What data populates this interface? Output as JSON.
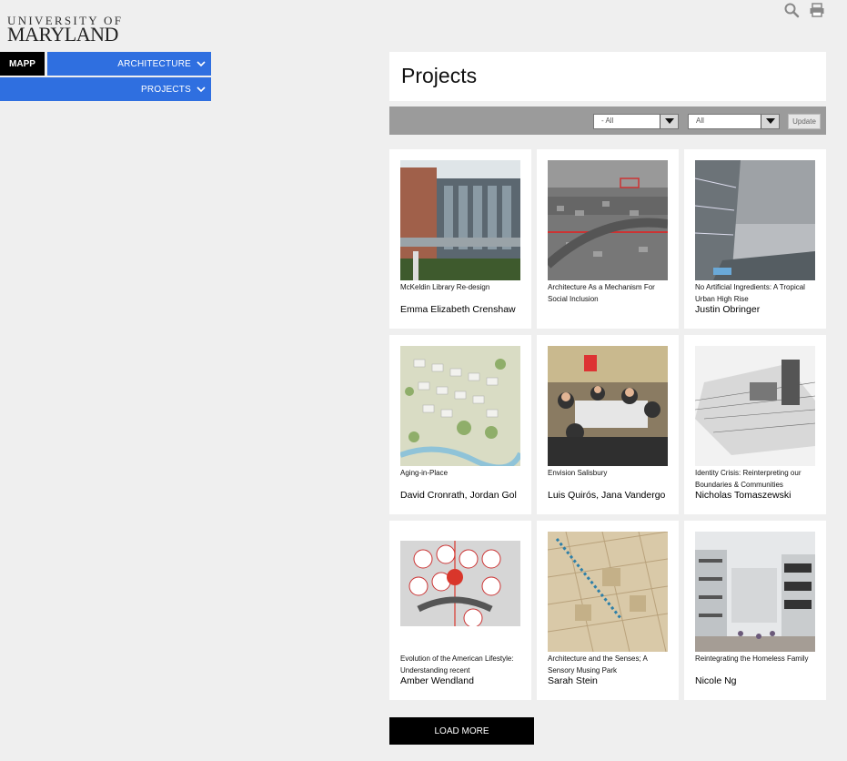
{
  "logo": {
    "line1": "UNIVERSITY OF",
    "line2": "MARYLAND"
  },
  "tools": {
    "search_icon": "search-icon",
    "print_icon": "print-icon"
  },
  "nav": {
    "mapp": "MAPP",
    "architecture": "ARCHITECTURE",
    "projects": "PROJECTS",
    "accent": "#2f6fe0"
  },
  "page": {
    "title": "Projects"
  },
  "filters": {
    "select1": "- All",
    "select2": "All",
    "update": "Update"
  },
  "projects": [
    {
      "title": "McKeldin Library Re-design",
      "author": "Emma Elizabeth Crenshaw"
    },
    {
      "title": "Architecture As a Mechanism For Social Inclusion",
      "author": ""
    },
    {
      "title": "No Artificial Ingredients: A Tropical Urban High Rise",
      "author": "Justin Obringer"
    },
    {
      "title": "Aging-in-Place",
      "author": "David Cronrath, Jordan Gol"
    },
    {
      "title": "Envision Salisbury",
      "author": "Luis Quirós, Jana Vandergo"
    },
    {
      "title": "Identity Crisis: Reinterpreting our Boundaries & Communities",
      "author": "Nicholas Tomaszewski"
    },
    {
      "title": "Evolution of the American Lifestyle: Understanding recent",
      "author": "Amber Wendland"
    },
    {
      "title": "Architecture and the Senses; A Sensory Musing Park",
      "author": "Sarah Stein"
    },
    {
      "title": "Reintegrating the Homeless Family",
      "author": "Nicole Ng"
    }
  ],
  "load_more": "LOAD MORE"
}
